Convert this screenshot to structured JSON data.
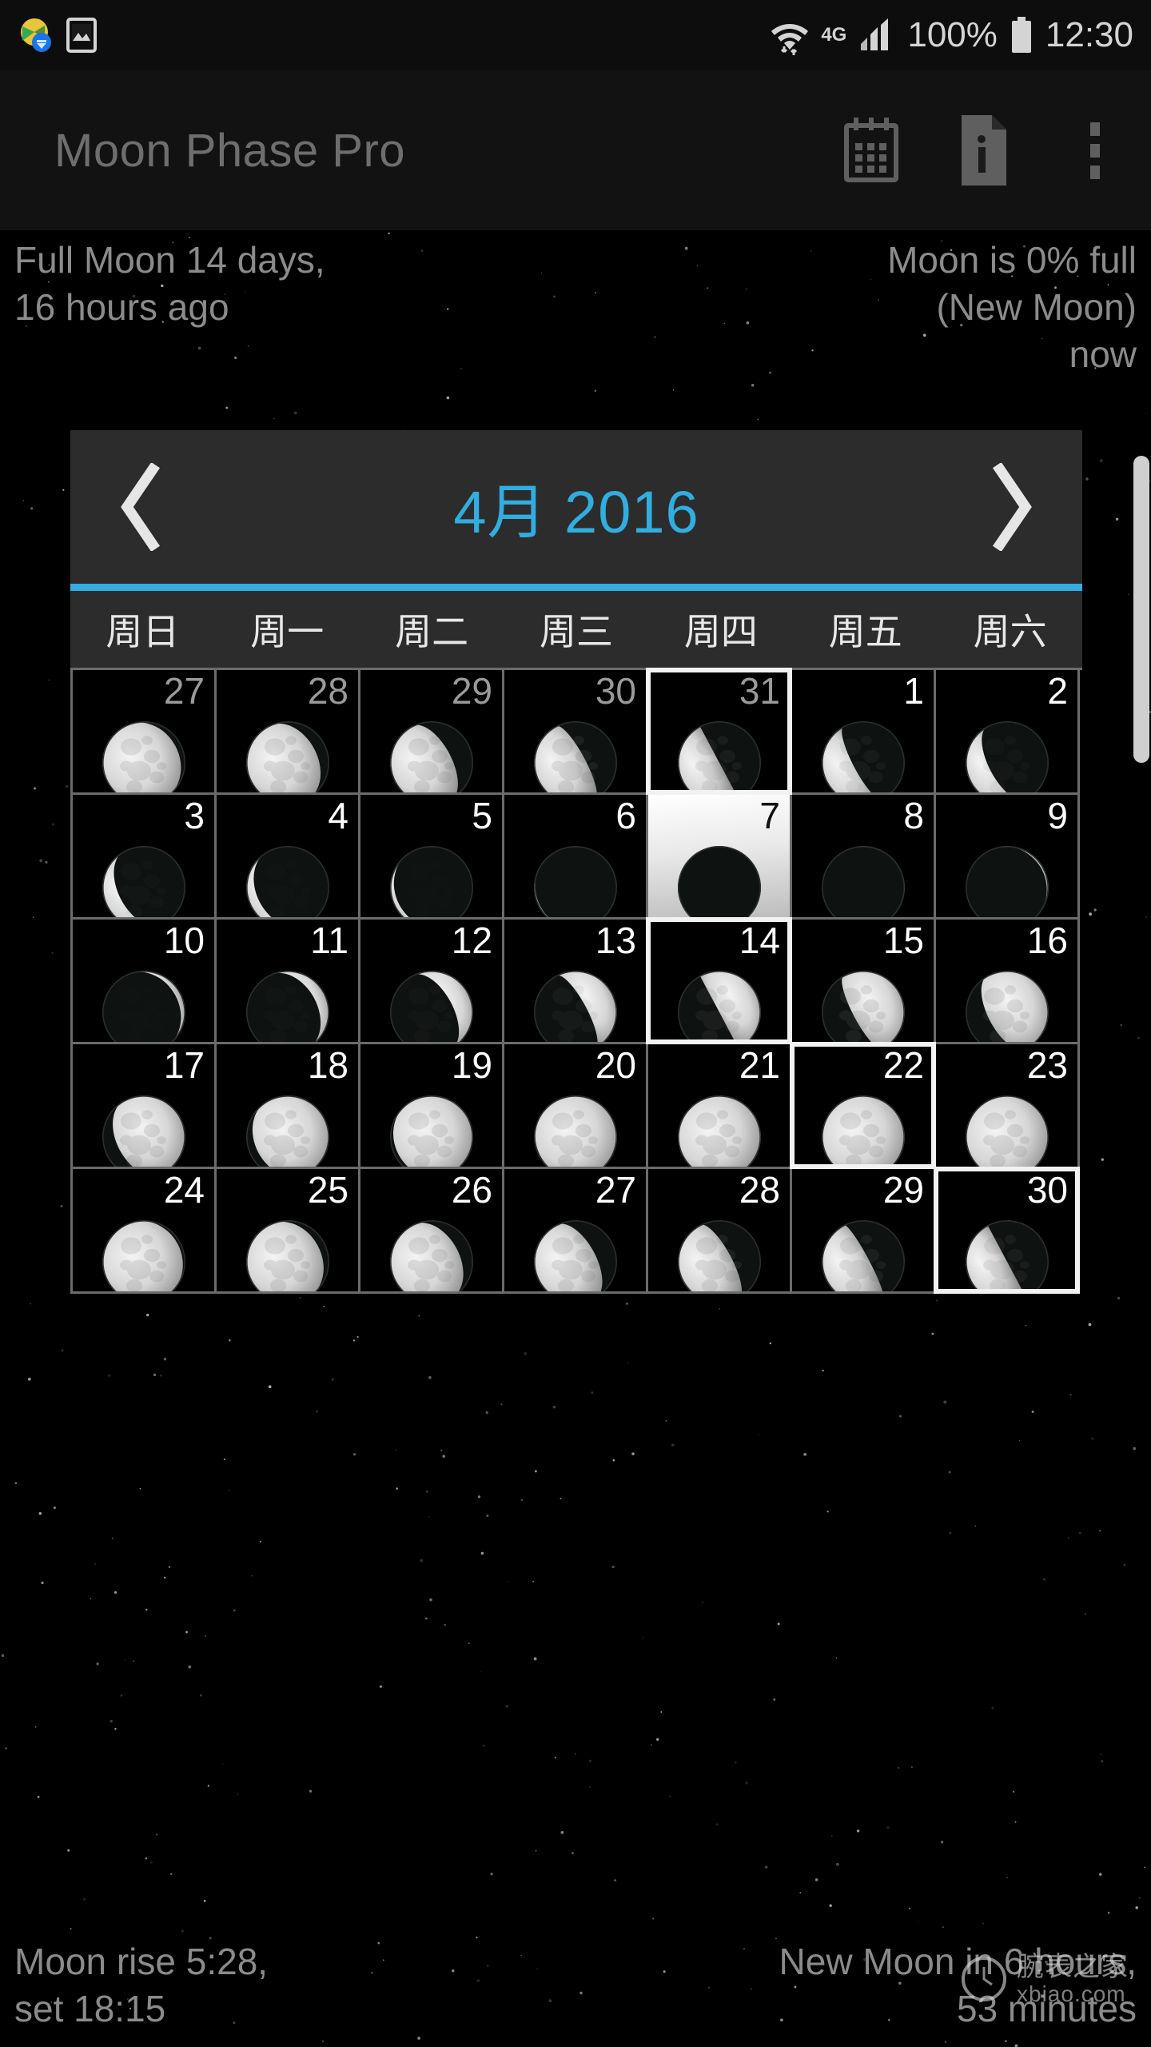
{
  "statusbar": {
    "network_label": "4G",
    "battery_percent": "100%",
    "clock": "12:30",
    "icons": [
      "play-store-update-icon",
      "gallery-image-icon",
      "wifi-icon",
      "signal-bars-icon",
      "battery-icon"
    ]
  },
  "actionbar": {
    "title": "Moon Phase Pro",
    "actions": [
      {
        "name": "calendar-icon",
        "label": "Calendar"
      },
      {
        "name": "info-document-icon",
        "label": "Info"
      },
      {
        "name": "overflow-menu-icon",
        "label": "More options"
      }
    ]
  },
  "info_top": {
    "left": "Full Moon 14 days,\n16 hours ago",
    "right": "Moon is 0% full\n(New Moon)\nnow"
  },
  "calendar": {
    "prev_label": "‹",
    "next_label": "›",
    "title": "4月 2016",
    "month": "4月",
    "year": "2016",
    "weekdays": [
      "周日",
      "周一",
      "周二",
      "周三",
      "周四",
      "周五",
      "周六"
    ],
    "accent_color": "#33ade2",
    "title_color": "#32ade0",
    "rows": [
      [
        {
          "day": "27",
          "other_month": true,
          "illum": 0.93,
          "waxing": false,
          "selected": false,
          "today": false
        },
        {
          "day": "28",
          "other_month": true,
          "illum": 0.86,
          "waxing": false,
          "selected": false,
          "today": false
        },
        {
          "day": "29",
          "other_month": true,
          "illum": 0.74,
          "waxing": false,
          "selected": false,
          "today": false
        },
        {
          "day": "30",
          "other_month": true,
          "illum": 0.62,
          "waxing": false,
          "selected": false,
          "today": false
        },
        {
          "day": "31",
          "other_month": true,
          "illum": 0.5,
          "waxing": false,
          "selected": true,
          "today": false
        },
        {
          "day": "1",
          "other_month": false,
          "illum": 0.38,
          "waxing": false,
          "selected": false,
          "today": false
        },
        {
          "day": "2",
          "other_month": false,
          "illum": 0.28,
          "waxing": false,
          "selected": false,
          "today": false
        }
      ],
      [
        {
          "day": "3",
          "other_month": false,
          "illum": 0.19,
          "waxing": false,
          "selected": false,
          "today": false
        },
        {
          "day": "4",
          "other_month": false,
          "illum": 0.12,
          "waxing": false,
          "selected": false,
          "today": false
        },
        {
          "day": "5",
          "other_month": false,
          "illum": 0.06,
          "waxing": false,
          "selected": false,
          "today": false
        },
        {
          "day": "6",
          "other_month": false,
          "illum": 0.02,
          "waxing": false,
          "selected": false,
          "today": false
        },
        {
          "day": "7",
          "other_month": false,
          "illum": 0.0,
          "waxing": false,
          "selected": false,
          "today": true
        },
        {
          "day": "8",
          "other_month": false,
          "illum": 0.01,
          "waxing": true,
          "selected": false,
          "today": false
        },
        {
          "day": "9",
          "other_month": false,
          "illum": 0.03,
          "waxing": true,
          "selected": false,
          "today": false
        }
      ],
      [
        {
          "day": "10",
          "other_month": false,
          "illum": 0.07,
          "waxing": true,
          "selected": false,
          "today": false
        },
        {
          "day": "11",
          "other_month": false,
          "illum": 0.14,
          "waxing": true,
          "selected": false,
          "today": false
        },
        {
          "day": "12",
          "other_month": false,
          "illum": 0.24,
          "waxing": true,
          "selected": false,
          "today": false
        },
        {
          "day": "13",
          "other_month": false,
          "illum": 0.36,
          "waxing": true,
          "selected": false,
          "today": false
        },
        {
          "day": "14",
          "other_month": false,
          "illum": 0.5,
          "waxing": true,
          "selected": true,
          "today": false
        },
        {
          "day": "15",
          "other_month": false,
          "illum": 0.62,
          "waxing": true,
          "selected": false,
          "today": false
        },
        {
          "day": "16",
          "other_month": false,
          "illum": 0.73,
          "waxing": true,
          "selected": false,
          "today": false
        }
      ],
      [
        {
          "day": "17",
          "other_month": false,
          "illum": 0.83,
          "waxing": true,
          "selected": false,
          "today": false
        },
        {
          "day": "18",
          "other_month": false,
          "illum": 0.9,
          "waxing": true,
          "selected": false,
          "today": false
        },
        {
          "day": "19",
          "other_month": false,
          "illum": 0.95,
          "waxing": true,
          "selected": false,
          "today": false
        },
        {
          "day": "20",
          "other_month": false,
          "illum": 0.98,
          "waxing": true,
          "selected": false,
          "today": false
        },
        {
          "day": "21",
          "other_month": false,
          "illum": 1.0,
          "waxing": true,
          "selected": false,
          "today": false
        },
        {
          "day": "22",
          "other_month": false,
          "illum": 1.0,
          "waxing": false,
          "selected": true,
          "today": false
        },
        {
          "day": "23",
          "other_month": false,
          "illum": 0.99,
          "waxing": false,
          "selected": false,
          "today": false
        }
      ],
      [
        {
          "day": "24",
          "other_month": false,
          "illum": 0.96,
          "waxing": false,
          "selected": false,
          "today": false
        },
        {
          "day": "25",
          "other_month": false,
          "illum": 0.91,
          "waxing": false,
          "selected": false,
          "today": false
        },
        {
          "day": "26",
          "other_month": false,
          "illum": 0.84,
          "waxing": false,
          "selected": false,
          "today": false
        },
        {
          "day": "27",
          "other_month": false,
          "illum": 0.75,
          "waxing": false,
          "selected": false,
          "today": false
        },
        {
          "day": "28",
          "other_month": false,
          "illum": 0.65,
          "waxing": false,
          "selected": false,
          "today": false
        },
        {
          "day": "29",
          "other_month": false,
          "illum": 0.57,
          "waxing": false,
          "selected": false,
          "today": false
        },
        {
          "day": "30",
          "other_month": false,
          "illum": 0.5,
          "waxing": false,
          "selected": true,
          "today": false
        }
      ]
    ]
  },
  "info_bottom": {
    "left": "Moon rise 5:28,\nset 18:15",
    "right": "New Moon in 6 hours,\n53 minutes"
  },
  "watermark": {
    "cn": "腕表之家",
    "en": "xbiao.com"
  }
}
